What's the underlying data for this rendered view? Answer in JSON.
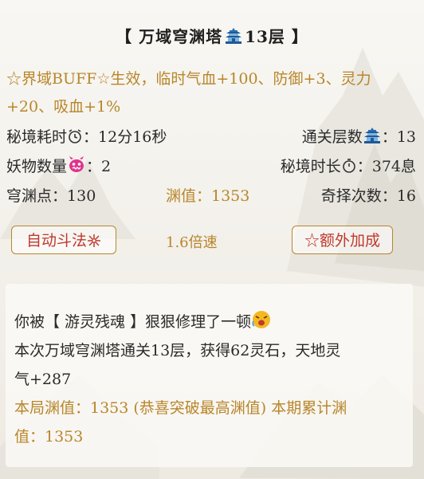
{
  "header": {
    "title_prefix": "【 万域穹渊塔",
    "title_suffix": "13层 】"
  },
  "buff": {
    "text": "☆界域BUFF☆生效，临时气血+100、防御+3、灵力+20、吸血+1%"
  },
  "stats": {
    "secret_time_label": "秘境耗时",
    "secret_time_value": "：12分16秒",
    "floors_label": "通关层数",
    "floors_value": "：13",
    "monsters_label": "妖物数量",
    "monsters_value": "：2",
    "duration_label": "秘境时长",
    "duration_value": "：374息",
    "abyss_points_label": "穹渊点",
    "abyss_points_value": "：130",
    "abyss_value_text": "渊值：1353",
    "choices_label": "奇择次数",
    "choices_value": "：16"
  },
  "controls": {
    "auto_fight_label": "自动斗法",
    "speed_text": "1.6倍速",
    "extra_bonus_label": "☆额外加成"
  },
  "log": {
    "line1_prefix": "你被【 游灵残魂 】狠狠修理了一顿",
    "line2": "本次万域穹渊塔通关13层，获得62灵石，天地灵",
    "line3": "气+287",
    "line4": "本局渊值：1353 (恭喜突破最高渊值)    本期累计渊",
    "line5": "值：1353"
  },
  "icons": {
    "tower": "pagoda-icon",
    "clock": "alarm-clock-icon",
    "monster": "monster-face-icon",
    "timer": "stopwatch-icon",
    "sparkle": "sparkle-icon",
    "emoji": "exhausted-face-icon"
  },
  "colors": {
    "gold": "#b8862b",
    "red_button_text": "#c0392b",
    "tower_blue": "#2a6fb5"
  }
}
